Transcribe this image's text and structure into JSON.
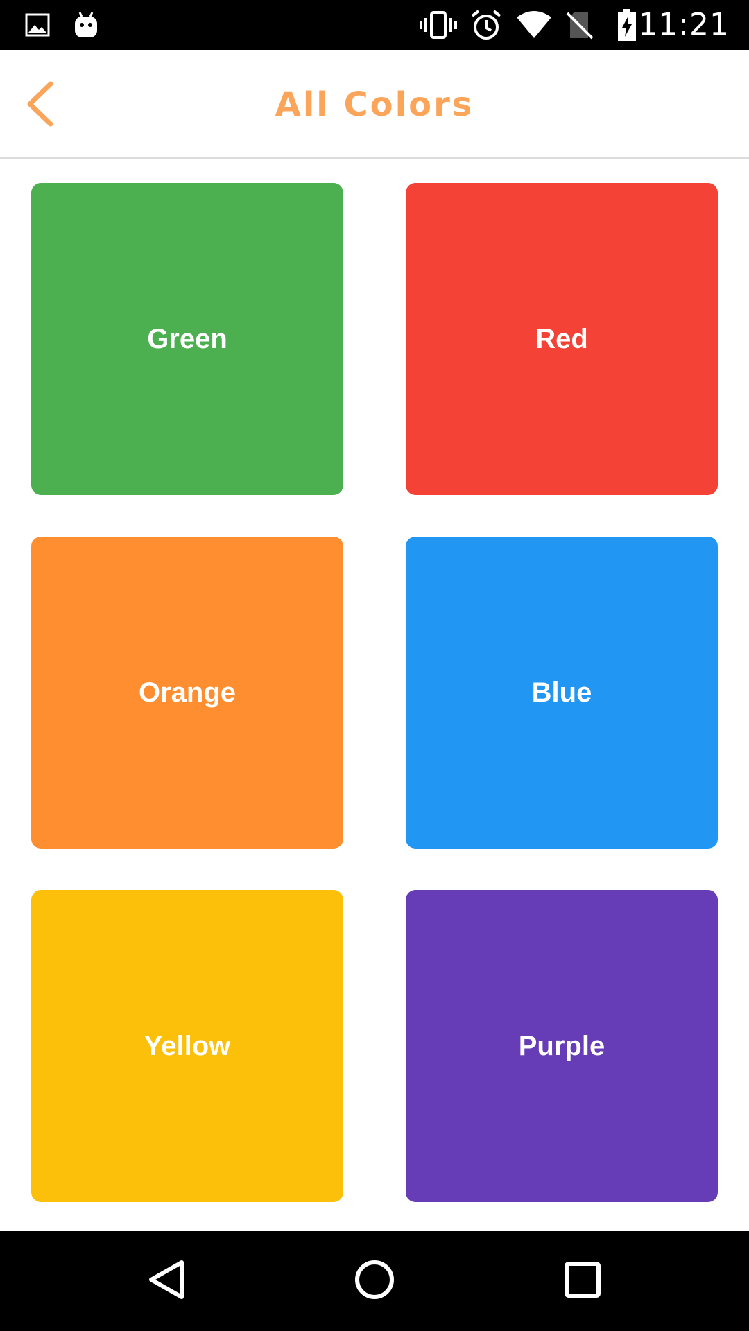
{
  "status_bar": {
    "time": "11:21",
    "icons": [
      "image-icon",
      "android-icon",
      "vibrate-icon",
      "alarm-icon",
      "wifi-icon",
      "no-sim-icon",
      "battery-charging-icon"
    ]
  },
  "header": {
    "title": "All Colors",
    "back_icon": "chevron-left-icon",
    "accent_color": "#fba55a"
  },
  "tiles": [
    {
      "label": "Green",
      "color": "#4caf50"
    },
    {
      "label": "Red",
      "color": "#f44336"
    },
    {
      "label": "Orange",
      "color": "#fe8e2f"
    },
    {
      "label": "Blue",
      "color": "#2196f3"
    },
    {
      "label": "Yellow",
      "color": "#fdc00a"
    },
    {
      "label": "Purple",
      "color": "#673db7"
    }
  ],
  "nav_bar": {
    "buttons": [
      "back-triangle-icon",
      "home-circle-icon",
      "recents-square-icon"
    ]
  }
}
